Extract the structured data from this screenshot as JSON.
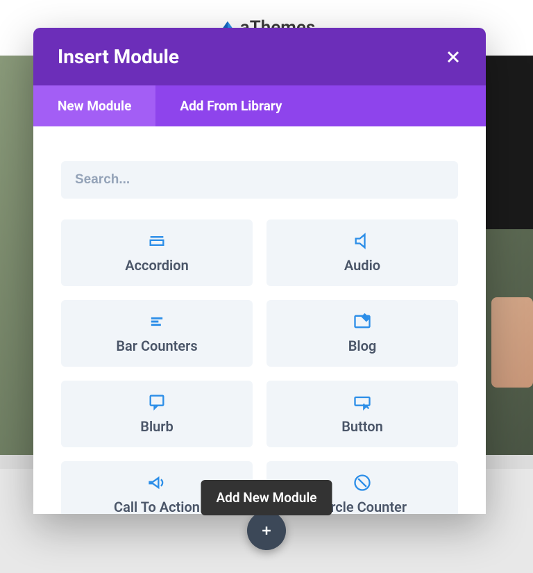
{
  "brand": "aThemes",
  "modal": {
    "title": "Insert Module",
    "tabs": [
      {
        "label": "New Module",
        "active": true
      },
      {
        "label": "Add From Library",
        "active": false
      }
    ],
    "search": {
      "placeholder": "Search..."
    },
    "modules": [
      {
        "icon": "accordion",
        "label": "Accordion"
      },
      {
        "icon": "audio",
        "label": "Audio"
      },
      {
        "icon": "bar-counters",
        "label": "Bar Counters"
      },
      {
        "icon": "blog",
        "label": "Blog"
      },
      {
        "icon": "blurb",
        "label": "Blurb"
      },
      {
        "icon": "button",
        "label": "Button"
      },
      {
        "icon": "call-to-action",
        "label": "Call To Action"
      },
      {
        "icon": "circle-counter",
        "label": "Circle Counter"
      }
    ]
  },
  "tooltip": "Add New Module"
}
